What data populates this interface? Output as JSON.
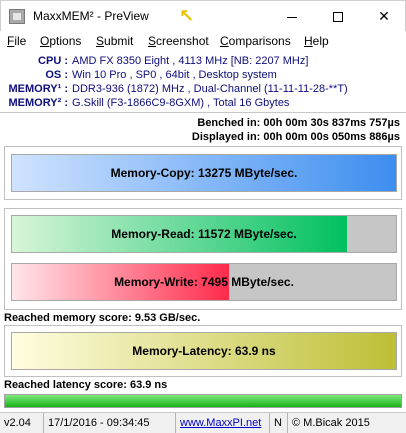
{
  "window": {
    "title": "MaxxMEM² - PreView",
    "minimize_label": "",
    "close_label": "✕"
  },
  "menu": [
    {
      "accel": "F",
      "rest": "ile"
    },
    {
      "accel": "O",
      "rest": "ptions"
    },
    {
      "accel": "S",
      "rest": "ubmit"
    },
    {
      "accel": "S",
      "rest": "creenshot"
    },
    {
      "accel": "C",
      "rest": "omparisons"
    },
    {
      "accel": "H",
      "rest": "elp"
    }
  ],
  "system": [
    {
      "label": "CPU :",
      "value": "AMD FX 8350 Eight , 4113 MHz  [NB: 2207 MHz]"
    },
    {
      "label": "OS :",
      "value": "Win 10 Pro , SP0 , 64bit , Desktop system"
    },
    {
      "label": "MEMORY¹ :",
      "value": "DDR3-936 (1872) MHz , Dual-Channel (11-11-11-28-**T)"
    },
    {
      "label": "MEMORY² :",
      "value": "G.Skill (F3-1866C9-8GXM) , Total 16 Gbytes"
    }
  ],
  "timing": {
    "benched": "Benched in: 00h 00m 30s 837ms 757µs",
    "displayed": "Displayed in: 00h 00m 00s 050ms 886µs"
  },
  "benchmarks": {
    "copy": {
      "label": "Memory-Copy: 13275 MByte/sec.",
      "fill": 1.0,
      "color_start": "#cfe3ff",
      "color_end": "#3d8ef0"
    },
    "read": {
      "label": "Memory-Read: 11572 MByte/sec.",
      "fill": 0.872,
      "color_start": "#d8f5d8",
      "color_end": "#00c060"
    },
    "write": {
      "label": "Memory-Write: 7495 MByte/sec.",
      "fill": 0.565,
      "color_start": "#ffe6ea",
      "color_end": "#ff2a4a"
    },
    "latency": {
      "label": "Memory-Latency: 63.9 ns",
      "fill": 0.0,
      "color_start": "#fffde0",
      "color_end": "#bdbf36"
    }
  },
  "memory_score": "Reached memory score: 9.53 GB/sec.",
  "latency_score": "Reached latency score: 63.9 ns",
  "progress": 1.0,
  "status": {
    "version": "v2.04",
    "datetime": "17/1/2016 - 09:34:45",
    "url": "www.MaxxPI.net",
    "mode": "N",
    "copyright": "© M.Bicak 2015"
  }
}
